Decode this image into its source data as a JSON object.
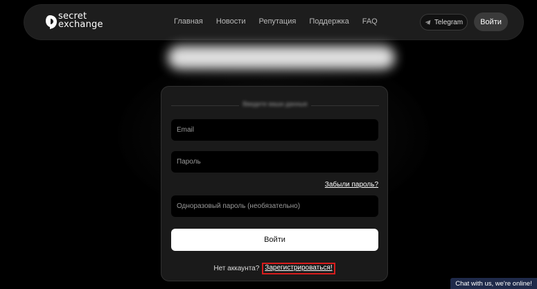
{
  "brand": {
    "logo_line_1": "secret",
    "logo_line_2": "exchange"
  },
  "nav": {
    "items": [
      {
        "label": "Главная"
      },
      {
        "label": "Новости"
      },
      {
        "label": "Репутация"
      },
      {
        "label": "Поддержка"
      },
      {
        "label": "FAQ"
      }
    ],
    "telegram_label": "Telegram",
    "login_label": "Войти"
  },
  "login": {
    "heading": "Введите ваши данные",
    "email_placeholder": "Email",
    "password_placeholder": "Пароль",
    "forgot_password": "Забыли пароль?",
    "otp_placeholder": "Одноразовый пароль (необязательно)",
    "submit_label": "Войти",
    "no_account": "Нет аккаунта?",
    "register_label": "Зарегистрироваться!"
  },
  "chat": {
    "label": "Chat with us, we're online!"
  },
  "colors": {
    "background": "#000000",
    "navbar": "#1d1d1d",
    "card": "#1a1a1a",
    "accent_highlight": "#d91d1d",
    "chat_widget": "#1f2a4a"
  }
}
